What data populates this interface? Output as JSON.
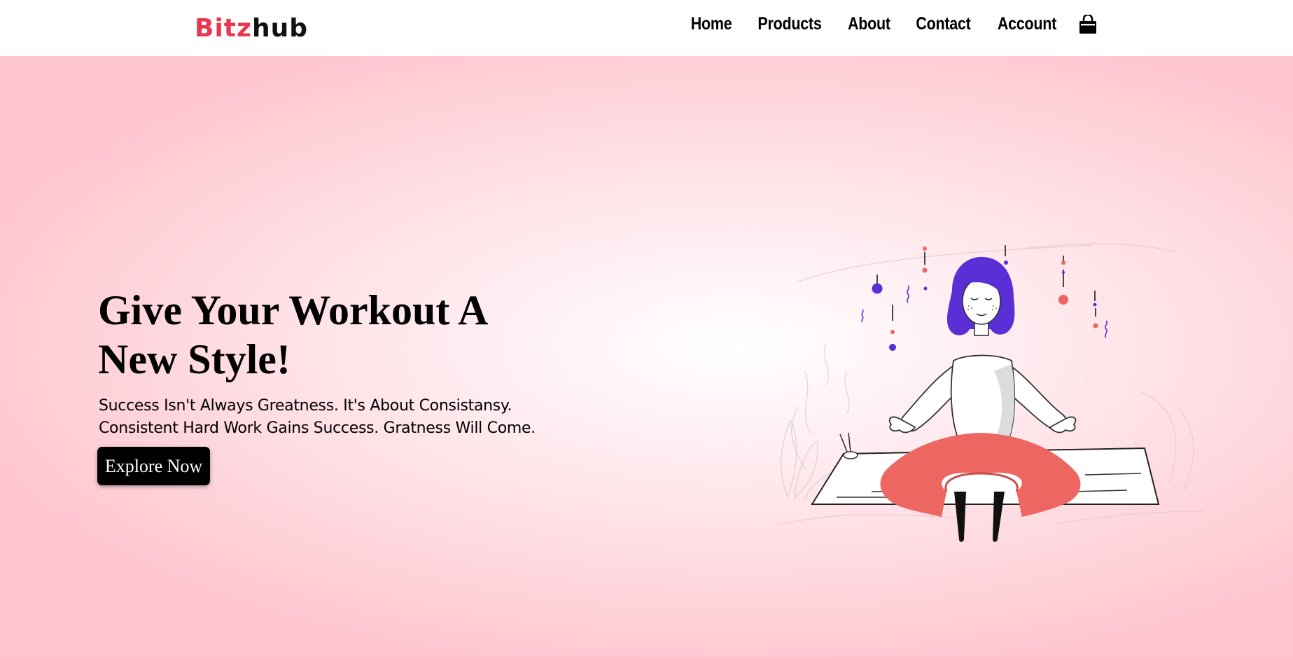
{
  "logo": {
    "part1": "Bitz",
    "part2": "hub"
  },
  "nav": {
    "items": [
      {
        "label": "Home"
      },
      {
        "label": "Products"
      },
      {
        "label": "About"
      },
      {
        "label": "Contact"
      },
      {
        "label": "Account"
      }
    ],
    "cart_icon": "shopping-bag-icon"
  },
  "hero": {
    "title": "Give Your Workout A New Style!",
    "text_line1": "Success Isn't Always Greatness. It's About Consistansy.",
    "text_line2": "Consistent Hard Work Gains Success. Gratness Will Come.",
    "button_label": "Explore Now",
    "illustration_icon": "meditating-woman-illustration"
  },
  "colors": {
    "brand_red": "#e8384f",
    "hero_pink": "#ffc6d0",
    "button_black": "#000000",
    "hair_purple": "#5a2fd6",
    "pants_red": "#ee6661"
  }
}
